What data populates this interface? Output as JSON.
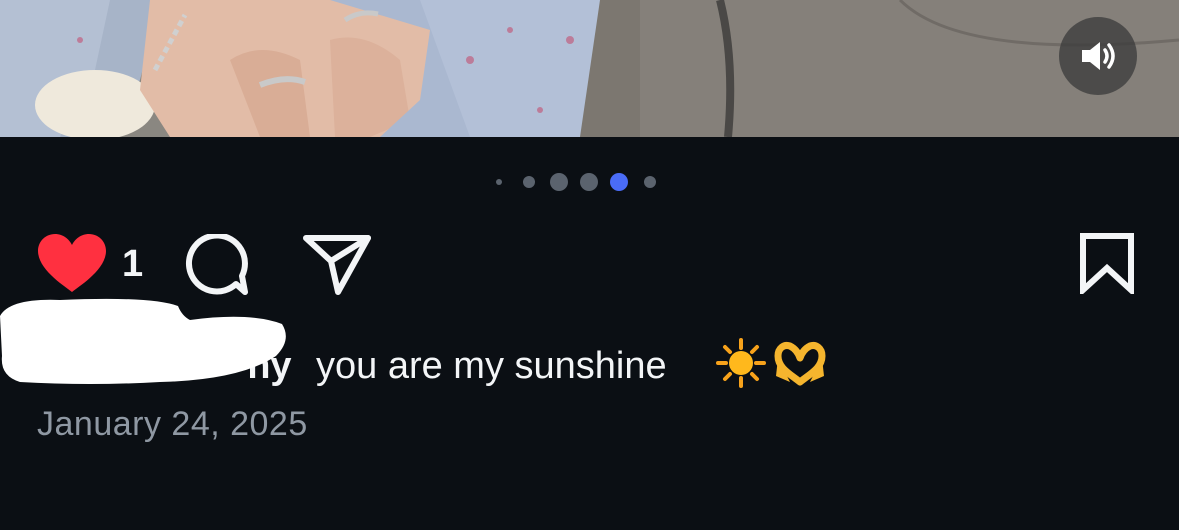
{
  "post": {
    "media": {
      "sound_icon": "speaker-volume-icon",
      "carousel_total": 6,
      "carousel_active": 5
    },
    "actions": {
      "like_icon": "heart-filled-icon",
      "like_count": "1",
      "comment_icon": "comment-bubble-icon",
      "share_icon": "paper-plane-icon",
      "save_icon": "bookmark-icon",
      "like_color": "#ff3040"
    },
    "caption": {
      "username_visible": "nny",
      "text": "you are my sunshine",
      "emoji_sun": "sun-emoji",
      "emoji_heart_hands": "heart-hands-emoji"
    },
    "date": "January 24, 2025",
    "colors": {
      "background": "#0b0f14",
      "text_primary": "#f3f5f7",
      "text_secondary": "#8f98a3",
      "dot_active": "#4a6cf7",
      "dot_inactive": "#5b636e"
    }
  }
}
